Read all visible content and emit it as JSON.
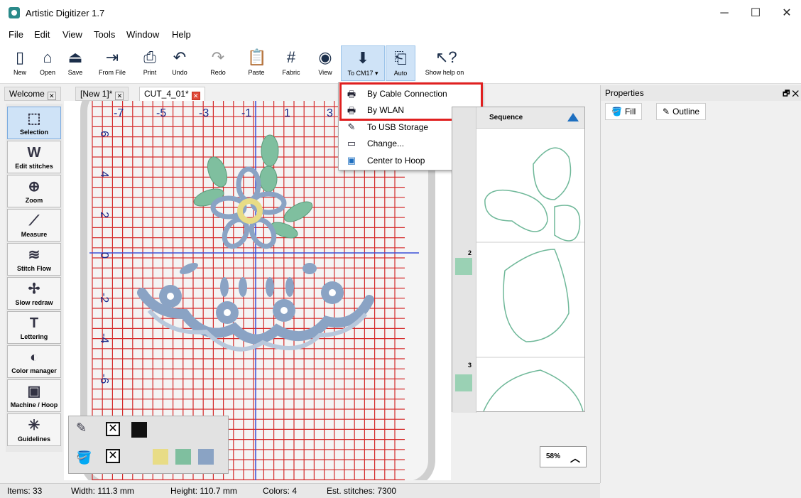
{
  "window": {
    "title": "Artistic Digitizer 1.7",
    "minimize": "─",
    "maximize": "☐",
    "close": "✕"
  },
  "menu": [
    "File",
    "Edit",
    "View",
    "Tools",
    "Window",
    "Help"
  ],
  "toolbar": [
    {
      "label": "New",
      "icon": "new-file-icon"
    },
    {
      "label": "Open",
      "icon": "open-folder-icon"
    },
    {
      "label": "Save",
      "icon": "save-icon"
    },
    {
      "label": "From File",
      "icon": "import-file-icon"
    },
    {
      "label": "Print",
      "icon": "printer-icon"
    },
    {
      "label": "Undo",
      "icon": "undo-icon"
    },
    {
      "label": "Redo",
      "icon": "redo-icon"
    },
    {
      "label": "Paste",
      "icon": "paste-icon"
    },
    {
      "label": "Fabric",
      "icon": "fabric-icon"
    },
    {
      "label": "View",
      "icon": "view-icon"
    },
    {
      "label": "To CM17",
      "icon": "send-to-machine-icon"
    },
    {
      "label": "Auto",
      "icon": "auto-icon"
    },
    {
      "label": "Show help on",
      "icon": "help-pointer-icon"
    }
  ],
  "tabs": [
    {
      "label": "Welcome",
      "active": false
    },
    {
      "label": "[New 1]*",
      "active": false
    },
    {
      "label": "CUT_4_01*",
      "active": true
    }
  ],
  "tools": [
    {
      "label": "Selection",
      "glyph": "⬚"
    },
    {
      "label": "Edit stitches",
      "glyph": "W"
    },
    {
      "label": "Zoom",
      "glyph": "⊕"
    },
    {
      "label": "Measure",
      "glyph": "⟋"
    },
    {
      "label": "Stitch Flow",
      "glyph": "≋"
    },
    {
      "label": "Slow redraw",
      "glyph": "✢"
    },
    {
      "label": "Lettering",
      "glyph": "T"
    },
    {
      "label": "Color manager",
      "glyph": "◐"
    },
    {
      "label": "Machine / Hoop",
      "glyph": "▣"
    },
    {
      "label": "Guidelines",
      "glyph": "✳"
    }
  ],
  "rulers": {
    "x_labels": [
      "-7",
      "-5",
      "-3",
      "-1",
      "1",
      "3"
    ],
    "y_labels": [
      "6",
      "4",
      "2",
      "0",
      "-2",
      "-4",
      "-6"
    ]
  },
  "dropdown": [
    {
      "label": "By Cable Connection",
      "icon": "cable-machine-icon"
    },
    {
      "label": "By WLAN",
      "icon": "wlan-machine-icon"
    },
    {
      "label": "To USB Storage",
      "icon": "usb-icon"
    },
    {
      "label": "Change...",
      "icon": "machine-change-icon"
    },
    {
      "label": "Center to Hoop",
      "icon": "center-hoop-icon"
    }
  ],
  "sequence": {
    "title": "Sequence",
    "items": [
      "2",
      "3"
    ]
  },
  "zoom": "58%",
  "properties": {
    "title": "Properties",
    "float_control": "🗗 ✕",
    "tabs": [
      "Fill",
      "Outline"
    ]
  },
  "status": {
    "items": "Items: 33",
    "width": "Width: 111.3 mm",
    "height": "Height: 110.7 mm",
    "colors": "Colors: 4",
    "stitches": "Est. stitches: 7300"
  },
  "colors": {
    "grid_red": "#d42a2a",
    "grid_blue": "#3a4fd6",
    "accent_blue": "#1e6fc0",
    "highlight": "#e02020",
    "thread_blue": "#8aa3c4",
    "thread_green": "#7fbf9f",
    "thread_yellow": "#e8dc86"
  }
}
